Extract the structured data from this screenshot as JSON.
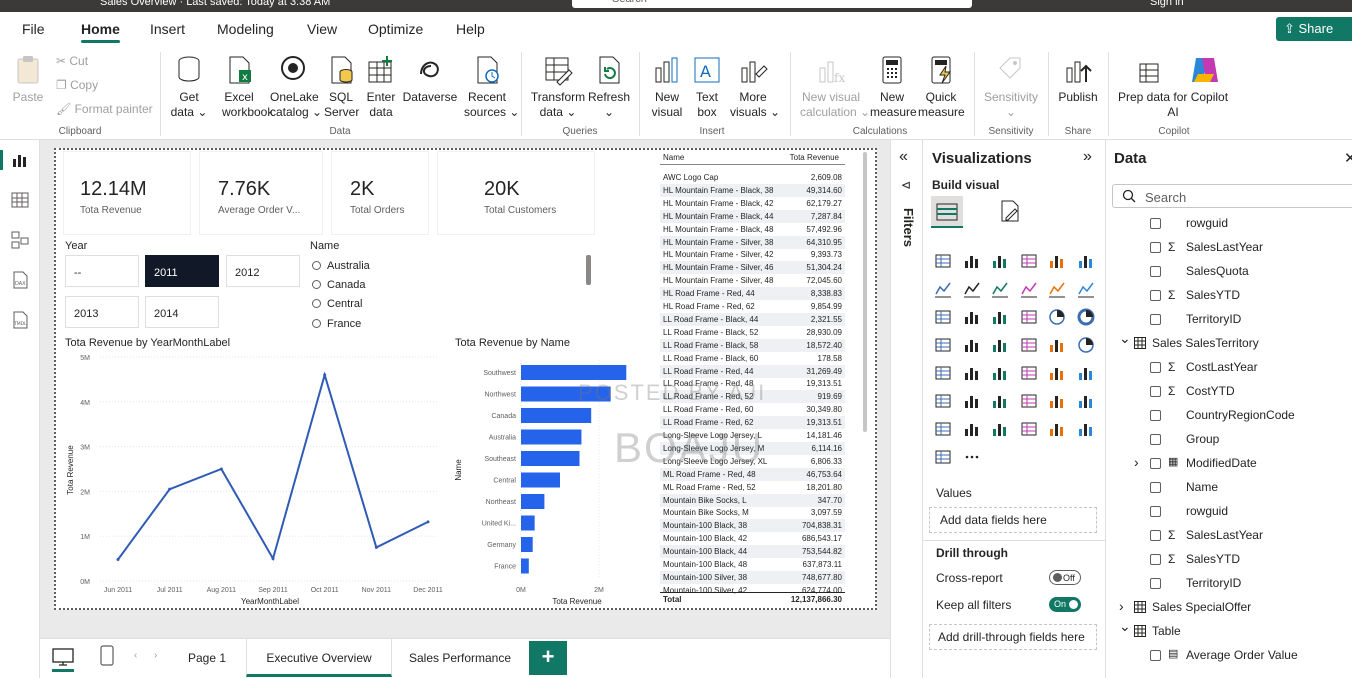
{
  "titlebar": {
    "title": "Sales Overview · Last saved: Today at 3:38 AM",
    "search": "Search",
    "signin": "Sign in"
  },
  "menu": {
    "tabs": [
      "File",
      "Home",
      "Insert",
      "Modeling",
      "View",
      "Optimize",
      "Help"
    ],
    "share": "Share"
  },
  "ribbon": {
    "clipboard": {
      "paste": "Paste",
      "cut": "Cut",
      "copy": "Copy",
      "format_painter": "Format painter",
      "group": "Clipboard"
    },
    "data": {
      "get_data": "Get\ndata ⌄",
      "excel": "Excel\nworkbook",
      "onelake": "OneLake\ncatalog ⌄",
      "sql": "SQL\nServer",
      "enter": "Enter\ndata",
      "dataverse": "Dataverse",
      "recent": "Recent\nsources ⌄",
      "group": "Data"
    },
    "queries": {
      "transform": "Transform\ndata ⌄",
      "refresh": "Refresh\n⌄",
      "group": "Queries"
    },
    "insert": {
      "new_visual": "New\nvisual",
      "text_box": "Text\nbox",
      "more_visuals": "More\nvisuals ⌄",
      "group": "Insert"
    },
    "calculations": {
      "new_visual_calc": "New visual\ncalculation ⌄",
      "new_measure": "New\nmeasure",
      "quick_measure": "Quick\nmeasure",
      "group": "Calculations"
    },
    "sensitivity": {
      "sensitivity": "Sensitivity\n⌄",
      "group": "Sensitivity"
    },
    "share": {
      "publish": "Publish",
      "group": "Share"
    },
    "copilot": {
      "prep": "Prep data for Copilot\nAI",
      "group": "Copilot"
    }
  },
  "cards": [
    {
      "value": "12.14M",
      "label": "Tota Revenue"
    },
    {
      "value": "7.76K",
      "label": "Average Order V..."
    },
    {
      "value": "2K",
      "label": "Total Orders"
    },
    {
      "value": "20K",
      "label": "Total Customers"
    }
  ],
  "year_slicer": {
    "title": "Year",
    "tiles": [
      "--",
      "2011",
      "2012",
      "2013",
      "2014"
    ],
    "selected": "2011"
  },
  "name_slicer": {
    "title": "Name",
    "options": [
      "Australia",
      "Canada",
      "Central",
      "France"
    ]
  },
  "line_chart": {
    "title": "Tota Revenue by YearMonthLabel",
    "xlabel": "YearMonthLabel",
    "ylabel": "Tota Revenue"
  },
  "bar_chart": {
    "title": "Tota Revenue by Name",
    "xlabel": "Tota Revenue",
    "ylabel": "Name"
  },
  "chart_data": [
    {
      "type": "line",
      "title": "Tota Revenue by YearMonthLabel",
      "xlabel": "YearMonthLabel",
      "ylabel": "Tota Revenue",
      "categories": [
        "Jun 2011",
        "Jul 2011",
        "Aug 2011",
        "Sep 2011",
        "Oct 2011",
        "Nov 2011",
        "Dec 2011"
      ],
      "values": [
        0.48,
        2.05,
        2.5,
        0.5,
        4.6,
        0.75,
        1.32
      ],
      "yticks": [
        "0M",
        "1M",
        "2M",
        "3M",
        "4M",
        "5M"
      ],
      "ylim": [
        0,
        5
      ],
      "unit": "M"
    },
    {
      "type": "bar",
      "title": "Tota Revenue by Name",
      "xlabel": "Tota Revenue",
      "ylabel": "Name",
      "categories": [
        "Southwest",
        "Northwest",
        "Canada",
        "Australia",
        "Southeast",
        "Central",
        "Northeast",
        "United Ki...",
        "Germany",
        "France"
      ],
      "values": [
        2.7,
        2.3,
        1.8,
        1.55,
        1.5,
        1.0,
        0.6,
        0.35,
        0.3,
        0.2
      ],
      "xticks": [
        "0M",
        "2M"
      ],
      "xlim": [
        0,
        3
      ],
      "unit": "M"
    }
  ],
  "table": {
    "headers": [
      "Name",
      "Tota Revenue"
    ],
    "rows": [
      [
        "AWC Logo Cap",
        "2,609.08"
      ],
      [
        "HL Mountain Frame - Black, 38",
        "49,314.60"
      ],
      [
        "HL Mountain Frame - Black, 42",
        "62,179.27"
      ],
      [
        "HL Mountain Frame - Black, 44",
        "7,287.84"
      ],
      [
        "HL Mountain Frame - Black, 48",
        "57,492.96"
      ],
      [
        "HL Mountain Frame - Silver, 38",
        "64,310.95"
      ],
      [
        "HL Mountain Frame - Silver, 42",
        "9,393.73"
      ],
      [
        "HL Mountain Frame - Silver, 46",
        "51,304.24"
      ],
      [
        "HL Mountain Frame - Silver, 48",
        "72,045.60"
      ],
      [
        "HL Road Frame - Red, 44",
        "8,338.83"
      ],
      [
        "HL Road Frame - Red, 62",
        "9,854.99"
      ],
      [
        "LL Road Frame - Black, 44",
        "2,321.55"
      ],
      [
        "LL Road Frame - Black, 52",
        "28,930.09"
      ],
      [
        "LL Road Frame - Black, 58",
        "18,572.40"
      ],
      [
        "LL Road Frame - Black, 60",
        "178.58"
      ],
      [
        "LL Road Frame - Red, 44",
        "31,269.49"
      ],
      [
        "LL Road Frame - Red, 48",
        "19,313.51"
      ],
      [
        "LL Road Frame - Red, 52",
        "919.69"
      ],
      [
        "LL Road Frame - Red, 60",
        "30,349.80"
      ],
      [
        "LL Road Frame - Red, 62",
        "19,313.51"
      ],
      [
        "Long-Sleeve Logo Jersey, L",
        "14,181.46"
      ],
      [
        "Long-Sleeve Logo Jersey, M",
        "6,114.16"
      ],
      [
        "Long-Sleeve Logo Jersey, XL",
        "6,806.33"
      ],
      [
        "ML Road Frame - Red, 48",
        "46,753.64"
      ],
      [
        "ML Road Frame - Red, 52",
        "18,201.80"
      ],
      [
        "Mountain Bike Socks, L",
        "347.70"
      ],
      [
        "Mountain Bike Socks, M",
        "3,097.59"
      ],
      [
        "Mountain-100 Black, 38",
        "704,838.31"
      ],
      [
        "Mountain-100 Black, 42",
        "686,543.17"
      ],
      [
        "Mountain-100 Black, 44",
        "753,544.82"
      ],
      [
        "Mountain-100 Black, 48",
        "637,873.11"
      ],
      [
        "Mountain-100 Silver, 38",
        "748,677.80"
      ],
      [
        "Mountain-100 Silver, 42",
        "624,774.00"
      ]
    ],
    "total_label": "Total",
    "total_value": "12,137,866.30"
  },
  "watermark": {
    "line1": "POSTED BY AJI",
    "line2": "BOAJU"
  },
  "filters": {
    "label": "Filters"
  },
  "viz": {
    "title": "Visualizations",
    "build": "Build visual",
    "values_label": "Values",
    "add_fields": "Add data fields here",
    "drill": "Drill through",
    "cross": "Cross-report",
    "cross_state": "Off",
    "keep": "Keep all filters",
    "keep_state": "On",
    "add_drill": "Add drill-through fields here"
  },
  "data": {
    "title": "Data",
    "search_placeholder": "Search",
    "fields": [
      {
        "name": "rowguid",
        "sigma": false,
        "level": 2
      },
      {
        "name": "SalesLastYear",
        "sigma": true,
        "level": 2
      },
      {
        "name": "SalesQuota",
        "sigma": false,
        "level": 2
      },
      {
        "name": "SalesYTD",
        "sigma": true,
        "level": 2
      },
      {
        "name": "TerritoryID",
        "sigma": false,
        "level": 2
      },
      {
        "name": "Sales SalesTerritory",
        "table": true,
        "expanded": true,
        "level": 1
      },
      {
        "name": "CostLastYear",
        "sigma": true,
        "level": 2
      },
      {
        "name": "CostYTD",
        "sigma": true,
        "level": 2
      },
      {
        "name": "CountryRegionCode",
        "sigma": false,
        "level": 2
      },
      {
        "name": "Group",
        "sigma": false,
        "level": 2
      },
      {
        "name": "ModifiedDate",
        "date": true,
        "level": 2
      },
      {
        "name": "Name",
        "sigma": false,
        "level": 2
      },
      {
        "name": "rowguid",
        "sigma": false,
        "level": 2
      },
      {
        "name": "SalesLastYear",
        "sigma": true,
        "level": 2
      },
      {
        "name": "SalesYTD",
        "sigma": true,
        "level": 2
      },
      {
        "name": "TerritoryID",
        "sigma": false,
        "level": 2
      },
      {
        "name": "Sales SpecialOffer",
        "table": true,
        "expanded": false,
        "level": 1
      },
      {
        "name": "Table",
        "table": true,
        "expanded": true,
        "level": 1
      },
      {
        "name": "Average Order Value",
        "calc": true,
        "level": 2
      }
    ]
  },
  "pages": {
    "tabs": [
      "Page 1",
      "Executive Overview",
      "Sales Performance"
    ],
    "active": "Executive Overview",
    "add": "+"
  },
  "colors": {
    "accent": "#117865",
    "bar": "#2563eb",
    "line": "#2f5bb7",
    "selected_tile": "#111827"
  }
}
